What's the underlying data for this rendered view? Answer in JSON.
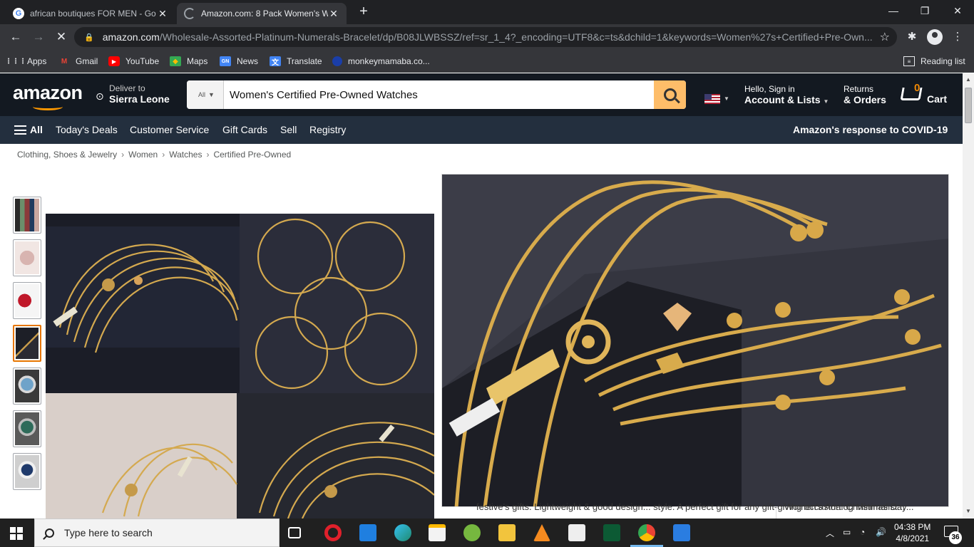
{
  "browser": {
    "tabs": [
      {
        "title": "african boutiques FOR MEN - Go",
        "favicon": "google-icon",
        "active": false
      },
      {
        "title": "Amazon.com: 8 Pack Women's W",
        "favicon": "loading-icon",
        "active": true
      }
    ],
    "url_host": "amazon.com",
    "url_path": "/Wholesale-Assorted-Platinum-Numerals-Bracelet/dp/B08JLWBSSZ/ref=sr_1_4?_encoding=UTF8&c=ts&dchild=1&keywords=Women%27s+Certified+Pre-Own...",
    "bookmarks": [
      "Apps",
      "Gmail",
      "YouTube",
      "Maps",
      "News",
      "Translate",
      "monkeymamaba.co..."
    ],
    "reading_list": "Reading list"
  },
  "amazon": {
    "deliver_small": "Deliver to",
    "deliver_location": "Sierra Leone",
    "search_category": "All",
    "search_query": "Women's Certified Pre-Owned Watches",
    "account_small": "Hello, Sign in",
    "account_big": "Account & Lists",
    "returns_small": "Returns",
    "returns_big": "& Orders",
    "cart_count": "0",
    "cart_label": "Cart",
    "nav_all": "All",
    "nav_items": [
      "Today's Deals",
      "Customer Service",
      "Gift Cards",
      "Sell",
      "Registry"
    ],
    "covid": "Amazon's response to COVID-19",
    "logo": "amazon",
    "breadcrumbs": [
      "Clothing, Shoes & Jewelry",
      "Women",
      "Watches",
      "Certified Pre-Owned"
    ],
    "below_text_left": "festive's gifts. Lightweight & good design... style. A perfect gift for any gift-giving occasion: Christmas Day...",
    "below_text_right": "Women's Analog Minimalist..."
  },
  "taskbar": {
    "search_placeholder": "Type here to search",
    "time": "04:38 PM",
    "date": "4/8/2021",
    "notifications": "36"
  },
  "colors": {
    "amazon_dark": "#131921",
    "amazon_nav": "#232f3e",
    "amazon_orange": "#ff9900",
    "search_button": "#febd69",
    "chrome_dark": "#202124",
    "chrome_toolbar": "#35363a"
  }
}
